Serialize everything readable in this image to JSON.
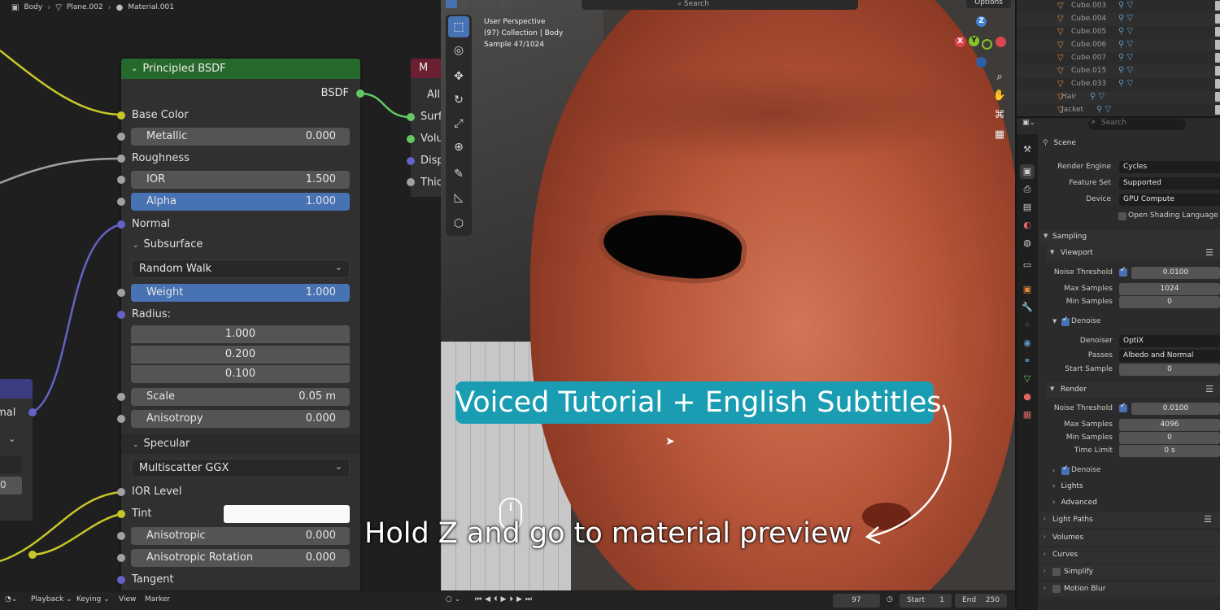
{
  "breadcrumb": [
    "Body",
    "Plane.002",
    "Material.001"
  ],
  "node": {
    "title": "Principled BSDF",
    "output": "BSDF",
    "rows": {
      "base_color": "Base Color",
      "metallic": {
        "label": "Metallic",
        "value": "0.000"
      },
      "roughness": "Roughness",
      "ior": {
        "label": "IOR",
        "value": "1.500"
      },
      "alpha": {
        "label": "Alpha",
        "value": "1.000"
      },
      "normal": "Normal",
      "subsurface": "Subsurface",
      "subsurface_method": "Random Walk",
      "weight": {
        "label": "Weight",
        "value": "1.000"
      },
      "radius_label": "Radius:",
      "radius": [
        "1.000",
        "0.200",
        "0.100"
      ],
      "scale": {
        "label": "Scale",
        "value": "0.05 m"
      },
      "anisotropy": {
        "label": "Anisotropy",
        "value": "0.000"
      },
      "specular": "Specular",
      "specular_method": "Multiscatter GGX",
      "ior_level": "IOR Level",
      "tint": "Tint",
      "anisotropic": {
        "label": "Anisotropic",
        "value": "0.000"
      },
      "anisotropic_rotation": {
        "label": "Anisotropic Rotation",
        "value": "0.000"
      },
      "tangent": "Tangent"
    }
  },
  "material_output_node": {
    "header": "M",
    "dropdown": "All",
    "inputs": [
      "Surf",
      "Volu",
      "Disp",
      "Thic"
    ]
  },
  "normal_map_node": {
    "output": "rmal",
    "value": "0"
  },
  "viewport": {
    "info": [
      "User Perspective",
      "(97) Collection | Body",
      "Sample 47/1024"
    ],
    "options": "Options",
    "search": "Search",
    "gizmo": {
      "z": "Z",
      "y": "Y",
      "x": "X"
    },
    "overlay_title": "Voiced Tutorial + English Subtitles",
    "hint": "Hold Z and go to material preview"
  },
  "outliner": {
    "items": [
      "Cube.003",
      "Cube.004",
      "Cube.005",
      "Cube.006",
      "Cube.007",
      "Cube.015",
      "Cube.033",
      "Hair",
      "Jacket"
    ]
  },
  "properties": {
    "search_placeholder": "Search",
    "scene": "Scene",
    "render_engine": {
      "label": "Render Engine",
      "value": "Cycles"
    },
    "feature_set": {
      "label": "Feature Set",
      "value": "Supported"
    },
    "device": {
      "label": "Device",
      "value": "GPU Compute"
    },
    "open_shading_language": "Open Shading Language",
    "sampling": "Sampling",
    "viewport_section": "Viewport",
    "viewport_noise_threshold": {
      "label": "Noise Threshold",
      "value": "0.0100"
    },
    "viewport_max_samples": {
      "label": "Max Samples",
      "value": "1024"
    },
    "viewport_min_samples": {
      "label": "Min Samples",
      "value": "0"
    },
    "denoise": "Denoise",
    "denoiser": {
      "label": "Denoiser",
      "value": "OptiX"
    },
    "passes": {
      "label": "Passes",
      "value": "Albedo and Normal"
    },
    "start_sample": {
      "label": "Start Sample",
      "value": "0"
    },
    "render_section": "Render",
    "render_noise_threshold": {
      "label": "Noise Threshold",
      "value": "0.0100"
    },
    "render_max_samples": {
      "label": "Max Samples",
      "value": "4096"
    },
    "render_min_samples": {
      "label": "Min Samples",
      "value": "0"
    },
    "time_limit": {
      "label": "Time Limit",
      "value": "0 s"
    },
    "render_denoise": "Denoise",
    "lights": "Lights",
    "advanced": "Advanced",
    "light_paths": "Light Paths",
    "volumes": "Volumes",
    "curves": "Curves",
    "simplify": "Simplify",
    "motion_blur": "Motion Blur"
  },
  "timeline": {
    "playback": "Playback",
    "keying": "Keying",
    "view": "View",
    "marker": "Marker",
    "current_frame": "97",
    "start_label": "Start",
    "start_value": "1",
    "end_label": "End",
    "end_value": "250"
  },
  "colors": {
    "node_header": "#27692c",
    "selection_blue": "#4772b3",
    "subtitle_bg": "#1a9db3",
    "socket_yellow": "#c7c729",
    "socket_gray": "#a1a1a1",
    "socket_purple": "#6363c7"
  }
}
